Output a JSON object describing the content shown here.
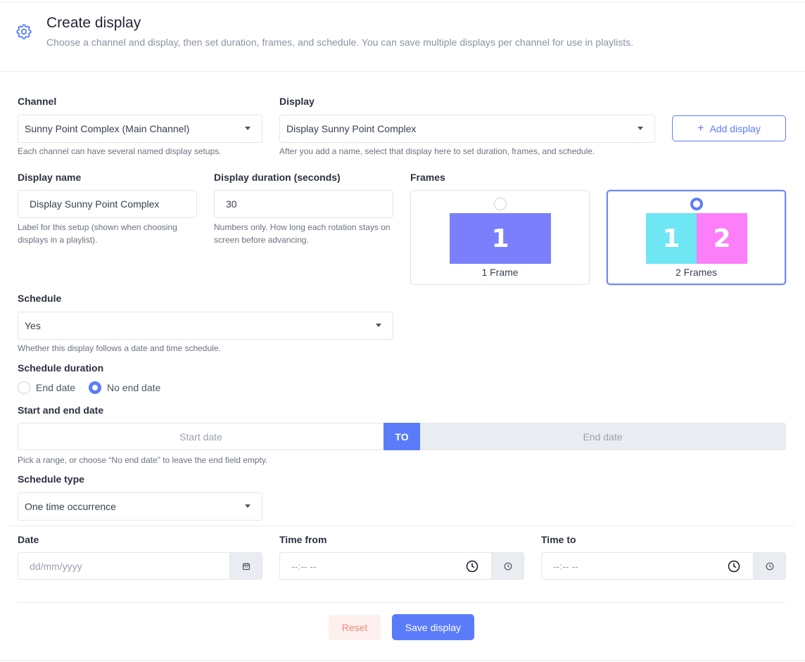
{
  "header": {
    "title": "Create display",
    "subtitle": "Choose a channel and display, then set duration, frames, and schedule. You can save multiple displays per channel for use in playlists."
  },
  "channel": {
    "label": "Channel",
    "value": "Sunny Point Complex (Main Channel)",
    "help": "Each channel can have several named display setups."
  },
  "display": {
    "label": "Display",
    "value": "Display Sunny Point Complex",
    "help": "After you add a name, select that display here to set duration, frames, and schedule.",
    "add_label": "Add display"
  },
  "display_name": {
    "label": "Display name",
    "value": "Display Sunny Point Complex",
    "help": "Label for this setup (shown when choosing displays in a playlist)."
  },
  "duration": {
    "label": "Display duration (seconds)",
    "value": "30",
    "help": "Numbers only. How long each rotation stays on screen before advancing."
  },
  "frames": {
    "label": "Frames",
    "options": [
      {
        "caption": "1 Frame",
        "cells": [
          "1"
        ],
        "colors": [
          "#7b7ffb"
        ],
        "selected": false
      },
      {
        "caption": "2 Frames",
        "cells": [
          "1",
          "2"
        ],
        "colors": [
          "#6fe6f3",
          "#fd7ef9"
        ],
        "selected": true
      }
    ]
  },
  "schedule": {
    "label": "Schedule",
    "value": "Yes",
    "help": "Whether this display follows a date and time schedule."
  },
  "schedule_duration": {
    "label": "Schedule duration",
    "options": [
      {
        "label": "End date",
        "selected": false
      },
      {
        "label": "No end date",
        "selected": true
      }
    ]
  },
  "date_range": {
    "label": "Start and end date",
    "start_placeholder": "Start date",
    "to_label": "TO",
    "end_placeholder": "End date",
    "help": "Pick a range, or choose “No end date” to leave the end field empty."
  },
  "schedule_type": {
    "label": "Schedule type",
    "value": "One time occurrence"
  },
  "date": {
    "label": "Date",
    "placeholder": "dd/mm/yyyy",
    "icon": "calendar-icon"
  },
  "time_from": {
    "label": "Time from",
    "placeholder": "--:-- --",
    "icon": "clock-icon"
  },
  "time_to": {
    "label": "Time to",
    "placeholder": "--:-- --",
    "icon": "clock-icon"
  },
  "actions": {
    "reset_label": "Reset",
    "save_label": "Save display"
  },
  "colors": {
    "accent": "#5b7cfa",
    "reset_text": "#f08a7a",
    "reset_bg": "#fdf0ee"
  }
}
